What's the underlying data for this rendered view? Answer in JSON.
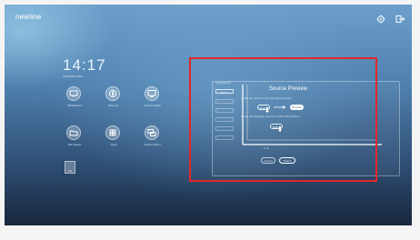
{
  "brand": "newline",
  "colors": {
    "highlight": "#e3262a",
    "background_top": "#6c9fcb",
    "background_bottom": "#18273d"
  },
  "home": {
    "time": "14:17",
    "date": "2019/09/25 Wed",
    "apps": [
      {
        "label": "Whiteboard",
        "icon": "whiteboard-icon"
      },
      {
        "label": "Browser",
        "icon": "browser-icon"
      },
      {
        "label": "Screen share",
        "icon": "screen-share-icon"
      },
      {
        "label": "File Viewer",
        "icon": "folder-icon"
      },
      {
        "label": "Apps",
        "icon": "apps-grid-icon"
      },
      {
        "label": "Screen Mirror",
        "icon": "mirror-icon"
      }
    ],
    "tile_label": "HD"
  },
  "source_preview": {
    "title": "Source Preview",
    "sidebar_title": "Input Source",
    "sidebar_first": "HDMI 1",
    "step1": "1. Tap the source to see the input preview",
    "step1_left": "Source",
    "step1_right": "Preview",
    "step2": "2. Tap and drag the source to switch the channel",
    "step2_button": "Switch",
    "pager": "1 / 2",
    "bottom_left": "Cancel",
    "bottom_right": "Switch"
  }
}
